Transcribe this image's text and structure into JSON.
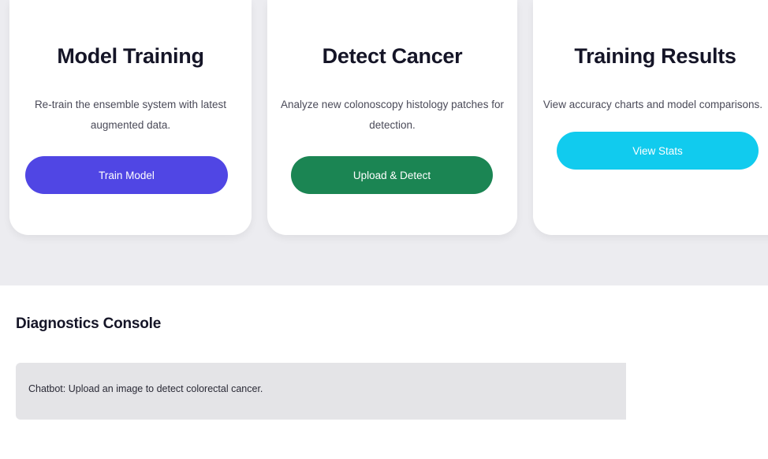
{
  "cards": [
    {
      "title": "Model Training",
      "description": "Re-train the ensemble system with latest augmented data.",
      "button_label": "Train Model",
      "button_color": "#5046e4"
    },
    {
      "title": "Detect Cancer",
      "description": "Analyze new colonoscopy histology patches for detection.",
      "button_label": "Upload & Detect",
      "button_color": "#1b8553"
    },
    {
      "title": "Training Results",
      "description": "View accuracy charts and model comparisons.",
      "button_label": "View Stats",
      "button_color": "#11cbee"
    }
  ],
  "console": {
    "title": "Diagnostics Console",
    "message": "Chatbot: Upload an image to detect colorectal cancer."
  },
  "colors": {
    "page_background": "#ececf0",
    "card_background": "#ffffff",
    "console_box": "#e4e4e7"
  }
}
